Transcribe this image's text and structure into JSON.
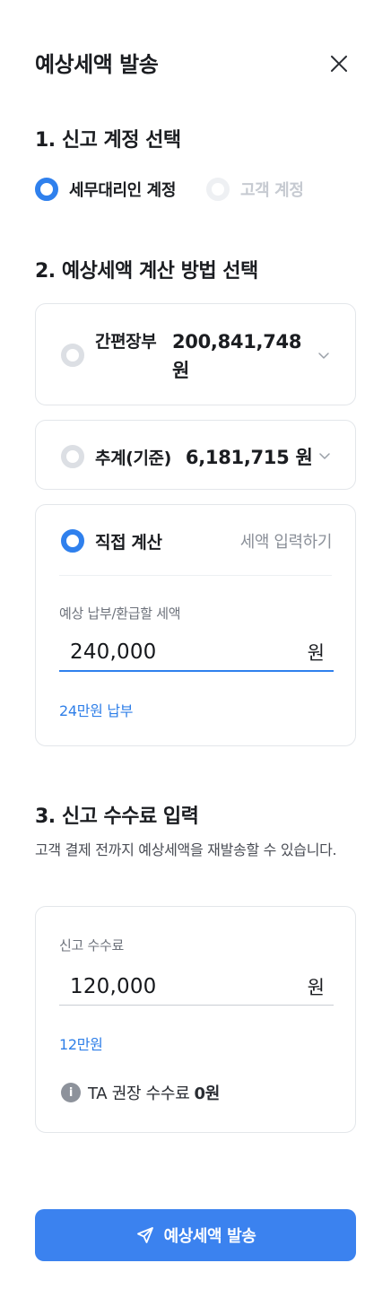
{
  "header": {
    "title": "예상세액 발송"
  },
  "section1": {
    "title": "1. 신고 계정 선택",
    "options": [
      {
        "label": "세무대리인 계정",
        "selected": true
      },
      {
        "label": "고객 계정",
        "selected": false
      }
    ]
  },
  "section2": {
    "title": "2. 예상세액 계산 방법 선택",
    "simple": {
      "name": "간편장부",
      "value": "200,841,748원",
      "selected": false
    },
    "estimate": {
      "name": "추계(기준)",
      "value": "6,181,715 원",
      "selected": false
    },
    "direct": {
      "name": "직접 계산",
      "hint": "세액 입력하기",
      "selected": true,
      "field_label": "예상 납부/환급할 세액",
      "field_value": "240,000",
      "unit": "원",
      "helper": "24만원 납부"
    }
  },
  "section3": {
    "title": "3. 신고 수수료 입력",
    "description": "고객 결제 전까지 예상세액을 재발송할 수 있습니다.",
    "field_label": "신고 수수료",
    "field_value": "120,000",
    "unit": "원",
    "helper": "12만원",
    "info_text": "TA 권장 수수료",
    "info_value": "0원"
  },
  "footer": {
    "send_label": "예상세액 발송"
  },
  "colors": {
    "accent": "#2f80ed",
    "button": "#3b82ef",
    "helper": "#2f7fe8"
  }
}
